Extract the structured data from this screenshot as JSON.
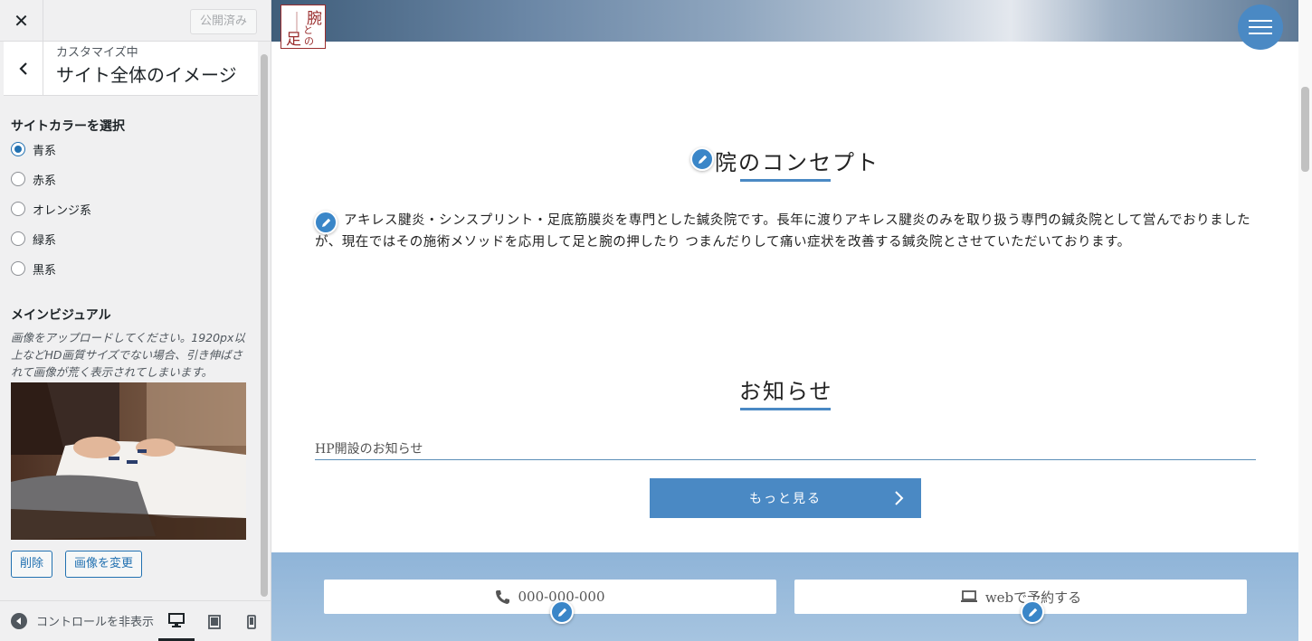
{
  "sidebar": {
    "close_icon": "close-icon",
    "publish_label": "公開済み",
    "section": {
      "subtitle": "カスタマイズ中",
      "title": "サイト全体のイメージ"
    },
    "site_color": {
      "title": "サイトカラーを選択",
      "options": [
        "青系",
        "赤系",
        "オレンジ系",
        "緑系",
        "黒系"
      ],
      "selected": "青系"
    },
    "main_visual": {
      "title": "メインビジュアル",
      "description": "画像をアップロードしてください。1920px以上などHD画質サイズでない場合、引き伸ばされて画像が荒く表示されてしまいます。",
      "delete_label": "削除",
      "change_label": "画像を変更"
    },
    "footer": {
      "collapse_label": "コントロールを非表示"
    }
  },
  "preview": {
    "logo_text": "腕と足の",
    "concept": {
      "title": "院のコンセプト",
      "body": "アキレス腱炎・シンスプリント・足底筋膜炎を専門とした鍼灸院です。長年に渡りアキレス腱炎のみを取り扱う専門の鍼灸院として営んでおりましたが、現在ではその施術メソッドを応用して足と腕の押したり つまんだりして痛い症状を改善する鍼灸院とさせていただいております。"
    },
    "news": {
      "title": "お知らせ",
      "items": [
        "HP開設のお知らせ"
      ],
      "more_label": "もっと見る"
    },
    "cta": {
      "phone": "000-000-000",
      "web": "webで予約する"
    }
  },
  "colors": {
    "accent": "#4a89c4",
    "wp_blue": "#2271b1",
    "logo_red": "#9a2d2d"
  }
}
